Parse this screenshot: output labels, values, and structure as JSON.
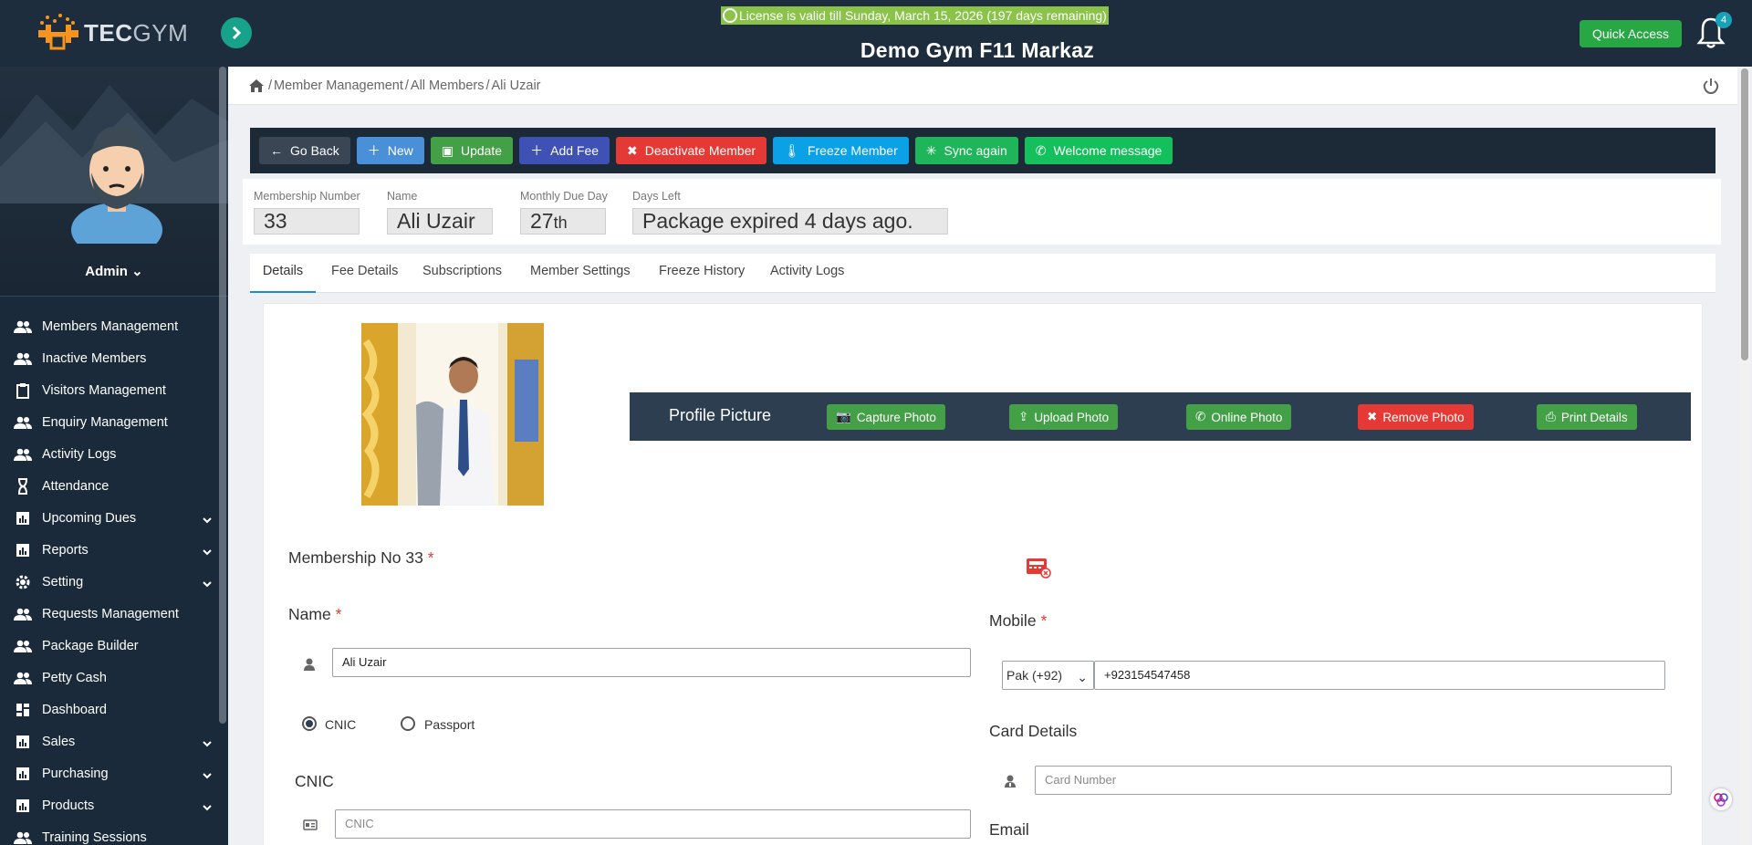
{
  "brand": {
    "tec": "TEC",
    "gym": "GYM"
  },
  "topbar": {
    "license": "License is valid till Sunday, March 15, 2026 (197 days remaining)",
    "gym_title": "Demo Gym F11 Markaz",
    "quick_access": "Quick Access",
    "notification_count": "4"
  },
  "user": {
    "role": "Admin"
  },
  "sidebar": {
    "items": [
      {
        "label": "Members Management",
        "icon": "users-icon"
      },
      {
        "label": "Inactive Members",
        "icon": "users-icon"
      },
      {
        "label": "Visitors Management",
        "icon": "clipboard-icon"
      },
      {
        "label": "Enquiry Management",
        "icon": "users-icon"
      },
      {
        "label": "Activity Logs",
        "icon": "users-icon"
      },
      {
        "label": "Attendance",
        "icon": "hourglass-icon"
      },
      {
        "label": "Upcoming Dues",
        "icon": "chart-icon",
        "expandable": true
      },
      {
        "label": "Reports",
        "icon": "chart-icon",
        "expandable": true
      },
      {
        "label": "Setting",
        "icon": "gear-icon",
        "expandable": true
      },
      {
        "label": "Requests Management",
        "icon": "users-icon"
      },
      {
        "label": "Package Builder",
        "icon": "users-icon"
      },
      {
        "label": "Petty Cash",
        "icon": "users-icon"
      },
      {
        "label": "Dashboard",
        "icon": "dashboard-icon"
      },
      {
        "label": "Sales",
        "icon": "chart-icon",
        "expandable": true
      },
      {
        "label": "Purchasing",
        "icon": "chart-icon",
        "expandable": true
      },
      {
        "label": "Products",
        "icon": "chart-icon",
        "expandable": true
      },
      {
        "label": "Training Sessions",
        "icon": "users-icon"
      }
    ]
  },
  "breadcrumb": [
    "Member Management",
    "All Members",
    "Ali Uzair"
  ],
  "actions": {
    "go_back": "Go Back",
    "new": "New",
    "update": "Update",
    "add_fee": "Add Fee",
    "deactivate": "Deactivate Member",
    "freeze": "Freeze Member",
    "sync": "Sync again",
    "welcome": "Welcome message"
  },
  "info": {
    "membership_number_label": "Membership Number",
    "membership_number": "33",
    "name_label": "Name",
    "name": "Ali Uzair",
    "due_day_label": "Monthly Due Day",
    "due_day": "27",
    "due_day_suffix": "th",
    "days_left_label": "Days Left",
    "days_left": "Package expired 4 days ago."
  },
  "tabs": [
    "Details",
    "Fee Details",
    "Subscriptions",
    "Member Settings",
    "Freeze History",
    "Activity Logs"
  ],
  "profile_picture": {
    "title": "Profile Picture",
    "capture": "Capture Photo",
    "upload": "Upload Photo",
    "online": "Online Photo",
    "remove": "Remove Photo",
    "print": "Print Details"
  },
  "form": {
    "membership_label": "Membership No 33",
    "name_label": "Name",
    "name_value": "Ali Uzair",
    "id_type": {
      "cnic": "CNIC",
      "passport": "Passport",
      "selected": "CNIC"
    },
    "cnic_label": "CNIC",
    "cnic_placeholder": "CNIC",
    "mobile_label": "Mobile",
    "country_code": "Pak (+92)",
    "mobile_value": "+923154547458",
    "card_label": "Card Details",
    "card_placeholder": "Card Number",
    "email_label": "Email"
  },
  "colors": {
    "sidebar_bg": "#1a2a3a",
    "accent_green": "#43a047",
    "license_bg": "#8bc34a",
    "danger": "#e53935"
  }
}
